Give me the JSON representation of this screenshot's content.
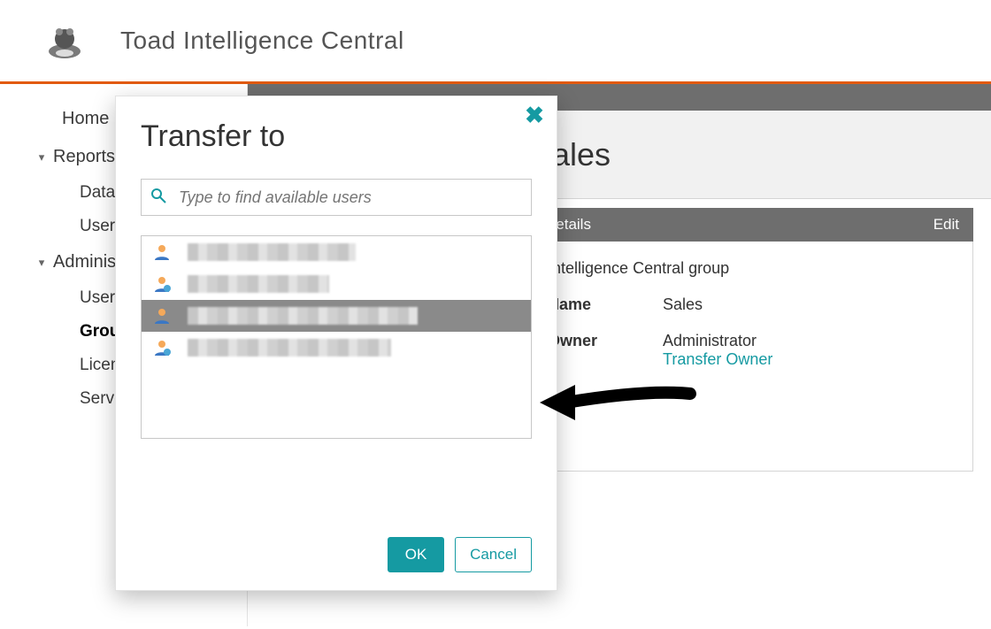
{
  "header": {
    "app_title": "Toad Intelligence Central"
  },
  "sidebar": {
    "home_label": "Home",
    "reports_label": "Reports",
    "reports_children": [
      {
        "label": "Data Connectivity"
      },
      {
        "label": "User Activity"
      }
    ],
    "admin_label": "Administration",
    "admin_children": [
      {
        "label": "Users"
      },
      {
        "label": "Groups",
        "selected": true
      },
      {
        "label": "Licensing"
      },
      {
        "label": "Server"
      }
    ]
  },
  "main": {
    "panel_title": "Sales",
    "details_header": "Details",
    "edit_label": "Edit",
    "group_type_text": "Intelligence Central group",
    "name_label": "Name",
    "name_value": "Sales",
    "owner_label": "Owner",
    "owner_value": "Administrator",
    "transfer_owner_link": "Transfer Owner"
  },
  "dialog": {
    "title": "Transfer to",
    "search_placeholder": "Type to find available users",
    "ok_label": "OK",
    "cancel_label": "Cancel",
    "users": [
      {
        "selected": false
      },
      {
        "selected": false
      },
      {
        "selected": true
      },
      {
        "selected": false
      }
    ]
  },
  "colors": {
    "accent": "#159aa2",
    "brand_orange": "#e25a0e"
  }
}
